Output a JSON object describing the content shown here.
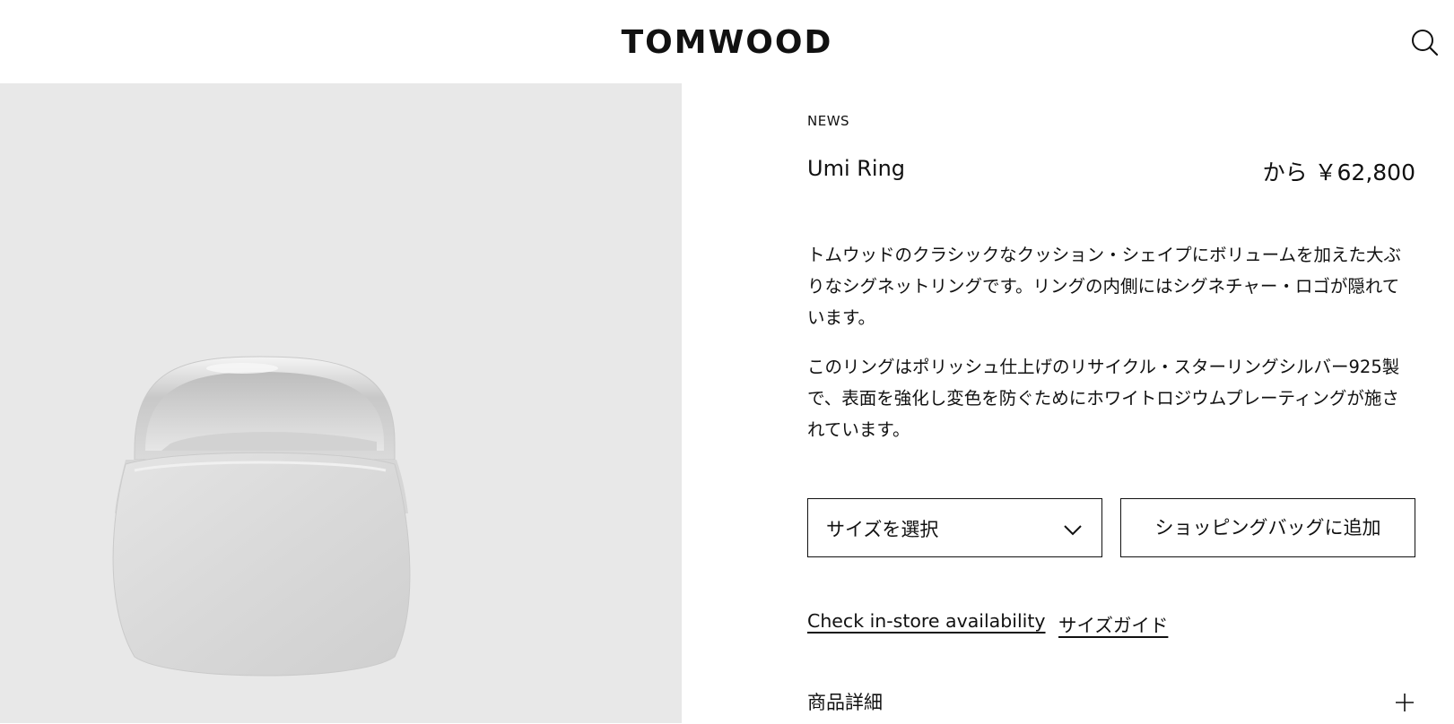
{
  "brand": {
    "logo_text": "TOMWOOD"
  },
  "header": {
    "search_icon": "search-icon"
  },
  "product": {
    "category": "NEWS",
    "name": "Umi Ring",
    "price": "から ￥62,800",
    "description": [
      "トムウッドのクラシックなクッション・シェイプにボリュームを加えた大ぶりなシグネットリングです。リングの内側にはシグネチャー・ロゴが隠れています。",
      "このリングはポリッシュ仕上げのリサイクル・スターリングシルバー925製で、表面を強化し変色を防ぐためにホワイトロジウムプレーティングが施されています。"
    ]
  },
  "actions": {
    "size_select_label": "サイズを選択",
    "size_select_icon": "chevron-down-icon",
    "add_to_bag_label": "ショッピングバッグに追加"
  },
  "links": {
    "store_availability": "Check in-store availability",
    "size_guide": "サイズガイド"
  },
  "accordion": {
    "details_label": "商品詳細",
    "expand_icon": "plus-icon"
  },
  "colors": {
    "image_background": "#e8e8e8",
    "text": "#111111",
    "background": "#ffffff"
  }
}
